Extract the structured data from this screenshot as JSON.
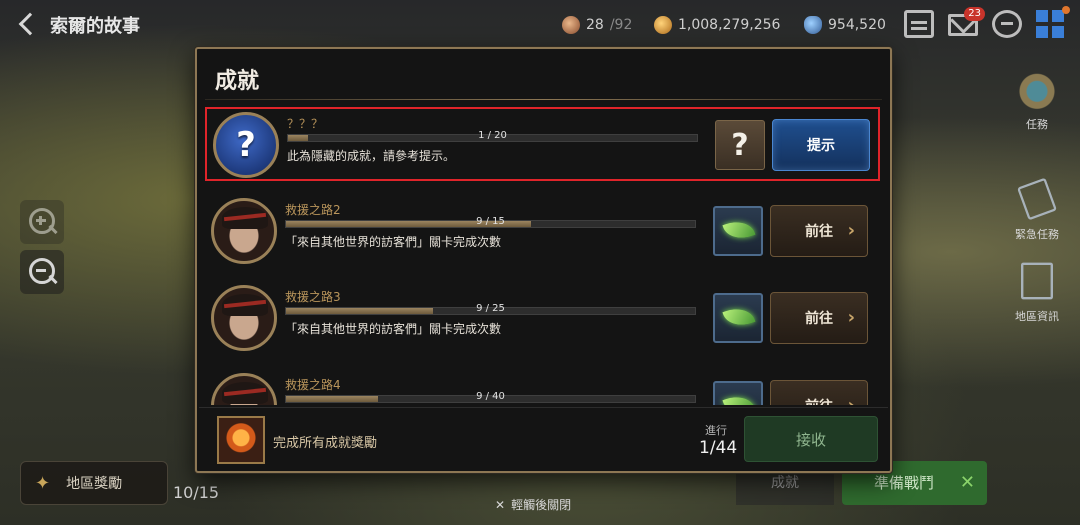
{
  "header": {
    "title": "索爾的故事",
    "stamina_current": "28",
    "stamina_max": "/92",
    "gold": "1,008,279,256",
    "gems": "954,520",
    "mail_badge": "23"
  },
  "left": {
    "region_reward_label": "地區獎勵",
    "region_progress": "10/15"
  },
  "right": {
    "quest_label": "任務",
    "emergency_label": "緊急任務",
    "region_info_label": "地區資訊",
    "start_battle_label": "準備戰鬥",
    "achievement_tab_label": "成就"
  },
  "modal": {
    "title": "成就",
    "achievements": [
      {
        "name": "？？？",
        "progress_text": "1 / 20",
        "progress": 0.05,
        "description": "此為隱藏的成就，請參考提示。",
        "reward_icon": "question-icon",
        "button": "提示"
      },
      {
        "name": "救援之路2",
        "progress_text": "9 / 15",
        "progress": 0.6,
        "description": "「來自其他世界的訪客們」關卡完成次數",
        "reward_icon": "leaf-icon",
        "button": "前往"
      },
      {
        "name": "救援之路3",
        "progress_text": "9 / 25",
        "progress": 0.36,
        "description": "「來自其他世界的訪客們」關卡完成次數",
        "reward_icon": "leaf-icon",
        "button": "前往"
      },
      {
        "name": "救援之路4",
        "progress_text": "9 / 40",
        "progress": 0.225,
        "description": "",
        "reward_icon": "leaf-icon",
        "button": "前往"
      }
    ],
    "footer": {
      "label": "完成所有成就獎勵",
      "progress_label": "進行",
      "progress": "1/44",
      "claim_button": "接收"
    }
  },
  "close_hint": "輕觸後關閉",
  "colors": {
    "modal_border": "#8d7754",
    "selected_outline": "#e0242a",
    "hint_button": "#1f4f8f",
    "claim_button": "#1f3a24"
  }
}
